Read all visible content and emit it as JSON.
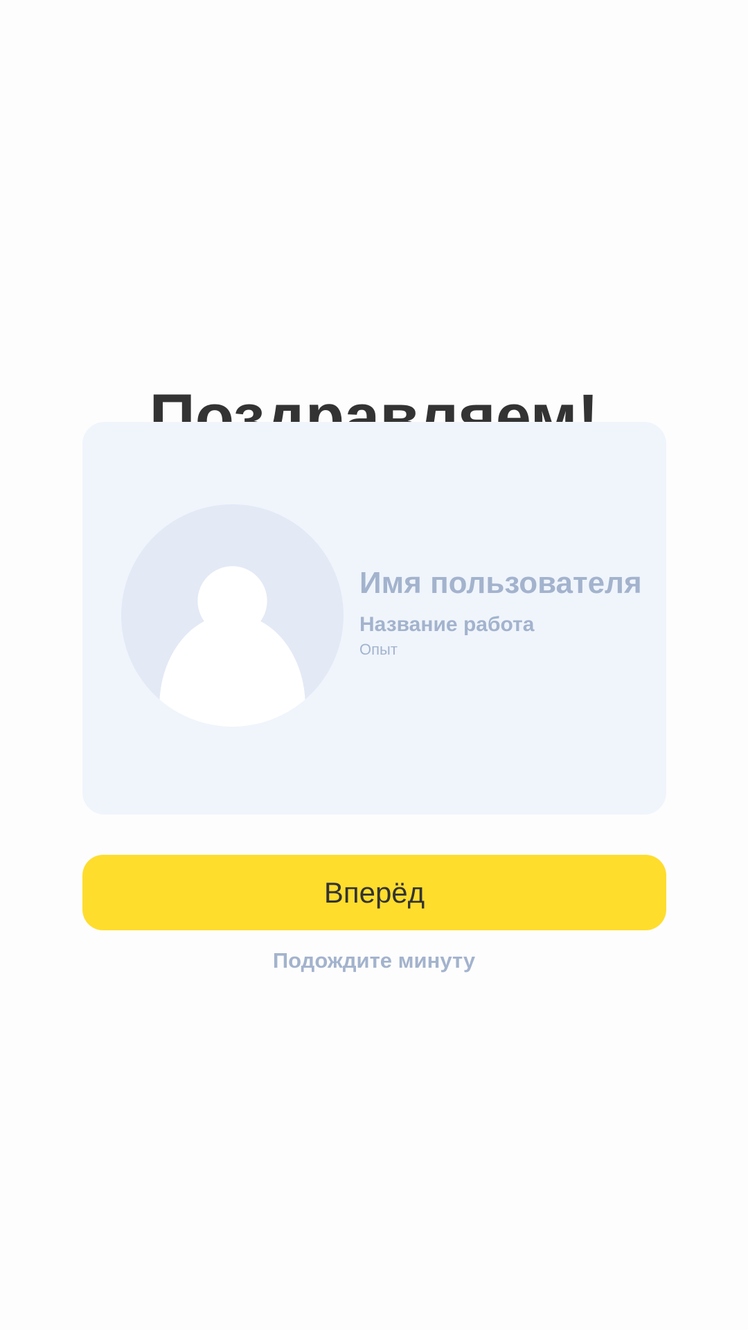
{
  "title": "Поздравляем!",
  "profile_card": {
    "user_name": "Имя пользователя",
    "job_title": "Название работа",
    "experience": "Опыт",
    "avatar_icon": "user-placeholder-icon"
  },
  "actions": {
    "primary_label": "Вперёд",
    "secondary_label": "Подождите минуту"
  },
  "colors": {
    "background": "#fdfdfd",
    "title_text": "#333333",
    "card_background": "#f0f5fc",
    "avatar_background": "#e3e9f5",
    "muted_text": "#a3b3cd",
    "primary_button": "#ffdd2d"
  }
}
